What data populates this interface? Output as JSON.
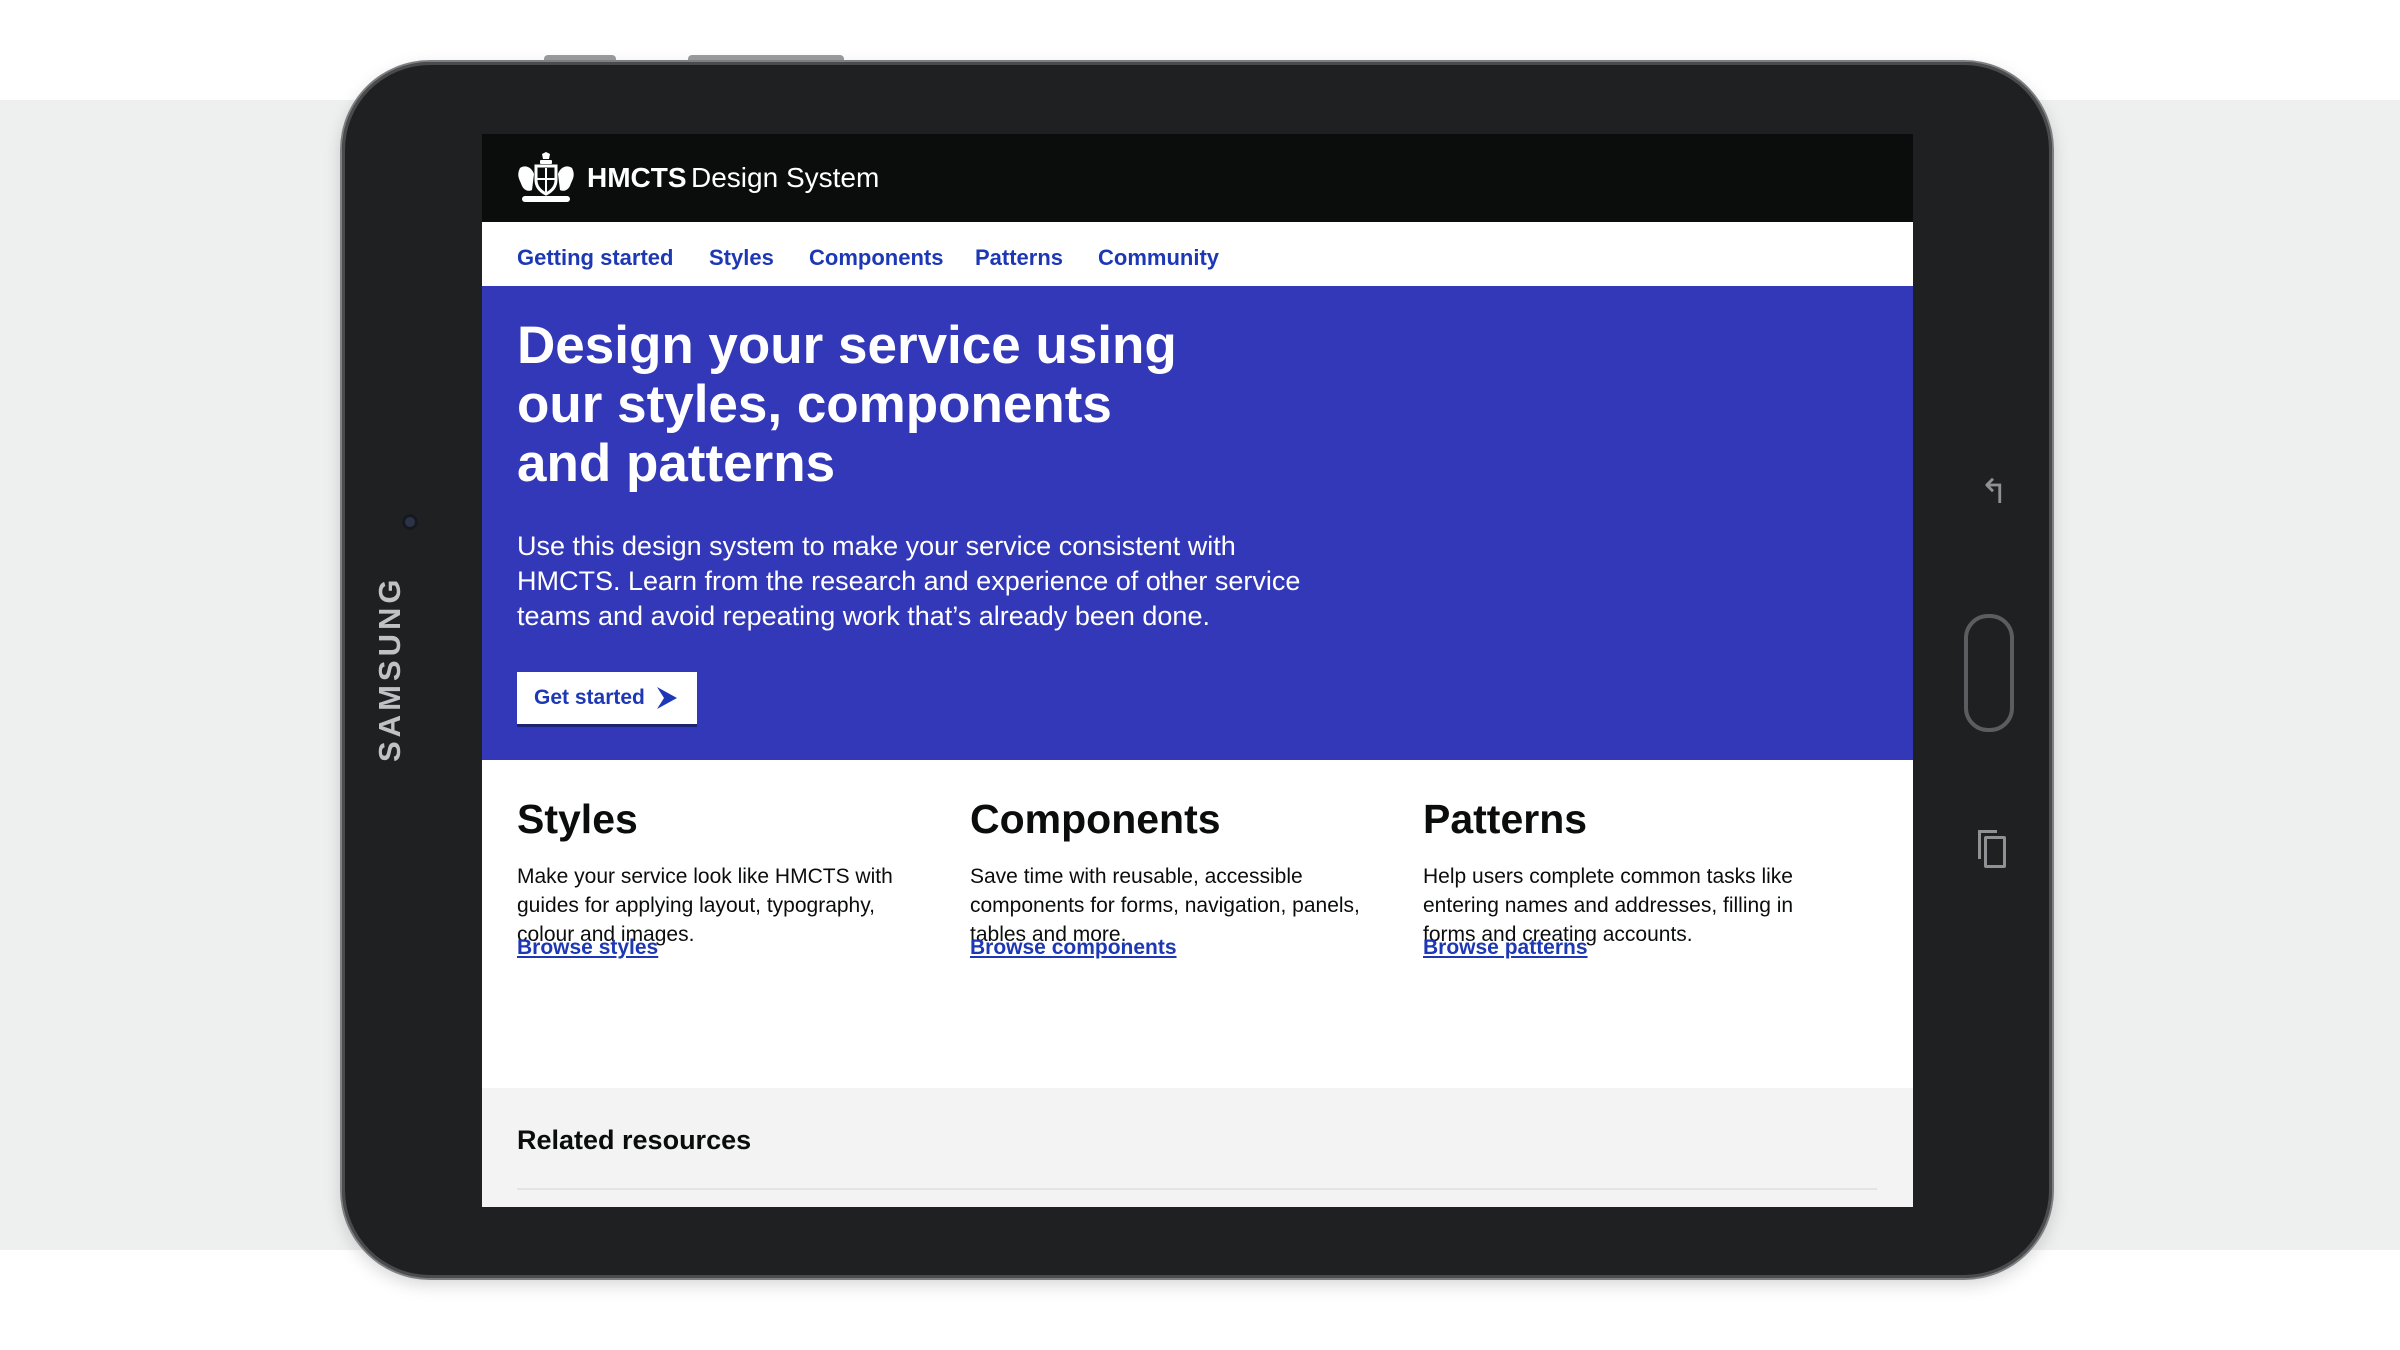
{
  "device": {
    "brand": "SAMSUNG",
    "icons": [
      "back-arrow-icon",
      "home-button",
      "recent-apps-icon"
    ]
  },
  "header": {
    "logo_strong": "HMCTS",
    "service_name": "Design System",
    "crest_icon": "royal-coat-of-arms-icon"
  },
  "nav": {
    "items": [
      "Getting started",
      "Styles",
      "Components",
      "Patterns",
      "Community"
    ]
  },
  "hero": {
    "title": "Design your service using our styles, components and patterns",
    "body": "Use this design system to make your service consistent with HMCTS. Learn from the research and experience of other service teams and avoid repeating work that’s already been done.",
    "cta_label": "Get started",
    "cta_icon": "chevron-right-icon",
    "background": "#3338b8"
  },
  "sections": [
    {
      "title": "Styles",
      "body": "Make your service look like HMCTS with guides for applying layout, typography, colour and images.",
      "link": "Browse styles"
    },
    {
      "title": "Components",
      "body": "Save time with reusable, accessible components for forms, navigation, panels, tables and more.",
      "link": "Browse components"
    },
    {
      "title": "Patterns",
      "body": "Help users complete common tasks like entering names and addresses, filling in forms and creating accounts.",
      "link": "Browse patterns"
    }
  ],
  "related": {
    "title": "Related resources"
  },
  "colors": {
    "header_bg": "#0b0c0c",
    "link": "#1d38b5",
    "related_bg": "#f3f3f3"
  }
}
